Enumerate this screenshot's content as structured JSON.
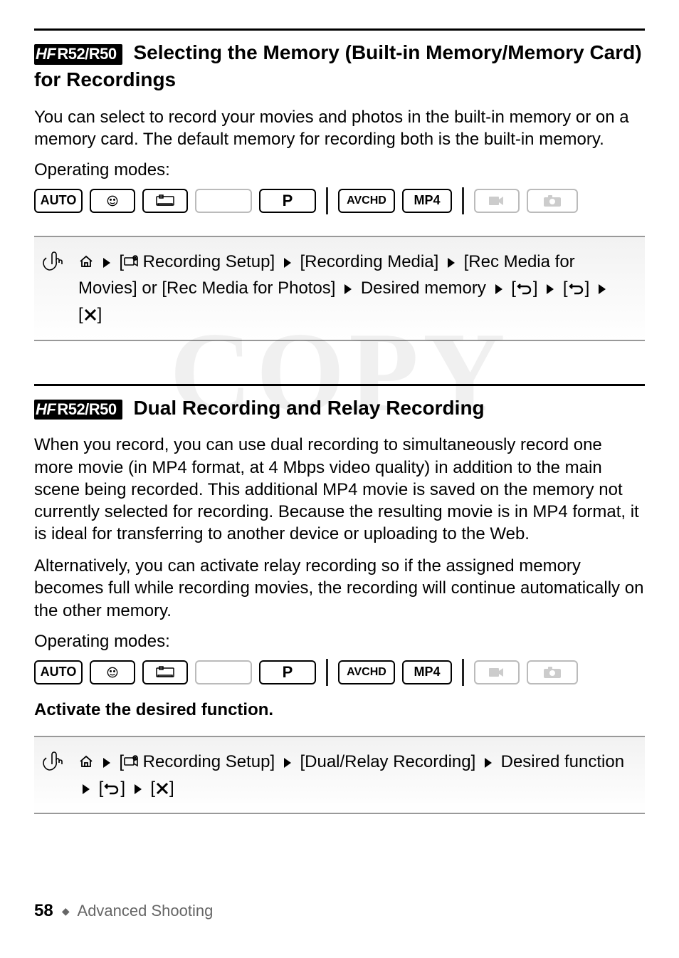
{
  "watermark": "COPY",
  "sections": [
    {
      "model_badge": {
        "hf": "HF",
        "rest": "R52/R50"
      },
      "title_rest": " Selecting the Memory (Built-in Memory/Memory Card) for Recordings",
      "body": "You can select to record your movies and photos in the built-in memory or on a memory card. The default memory for recording both is the built-in memory.",
      "op_label": "Operating modes:",
      "modes": {
        "auto": "AUTO",
        "p": "P",
        "avchd": "AVCHD",
        "mp4": "MP4"
      },
      "steps": {
        "rec_setup": " Recording Setup]",
        "rec_media": "[Recording Media]",
        "rec_media_movies": "[Rec Media for Movies] or [Rec Media for Photos]",
        "desired": "Desired memory"
      }
    },
    {
      "model_badge": {
        "hf": "HF",
        "rest": "R52/R50"
      },
      "title_rest": " Dual Recording and Relay Recording",
      "body1": "When you record, you can use dual recording to simultaneously record one more movie (in MP4 format, at 4 Mbps video quality) in addition to the main scene being recorded. This additional MP4 movie is saved on the memory not currently selected for recording. Because the resulting movie is in MP4 format, it is ideal for transferring to another device or uploading to the Web.",
      "body2": "Alternatively, you can activate relay recording so if the assigned memory becomes full while recording movies, the recording will continue automatically on the other memory.",
      "op_label": "Operating modes:",
      "modes": {
        "auto": "AUTO",
        "p": "P",
        "avchd": "AVCHD",
        "mp4": "MP4"
      },
      "subheading": "Activate the desired function.",
      "steps": {
        "rec_setup": " Recording Setup]",
        "dual_relay": "[Dual/Relay Recording]",
        "desired": "Desired function"
      }
    }
  ],
  "footer": {
    "page_num": "58",
    "section": "Advanced Shooting"
  }
}
